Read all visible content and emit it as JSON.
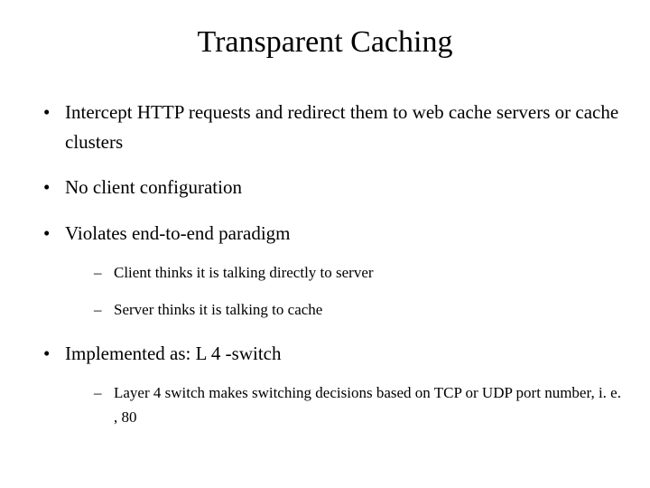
{
  "title": "Transparent Caching",
  "bullets": [
    {
      "text": "Intercept HTTP requests and redirect them to web cache servers or cache clusters",
      "sub": []
    },
    {
      "text": "No client configuration",
      "sub": []
    },
    {
      "text": "Violates end-to-end paradigm",
      "sub": [
        {
          "text": "Client thinks it is talking directly to server"
        },
        {
          "text": "Server thinks it is talking to cache"
        }
      ]
    },
    {
      "text": "Implemented as: L 4 -switch",
      "sub": [
        {
          "text": "Layer 4 switch makes switching decisions based on TCP or UDP port number, i. e. , 80"
        }
      ]
    }
  ]
}
